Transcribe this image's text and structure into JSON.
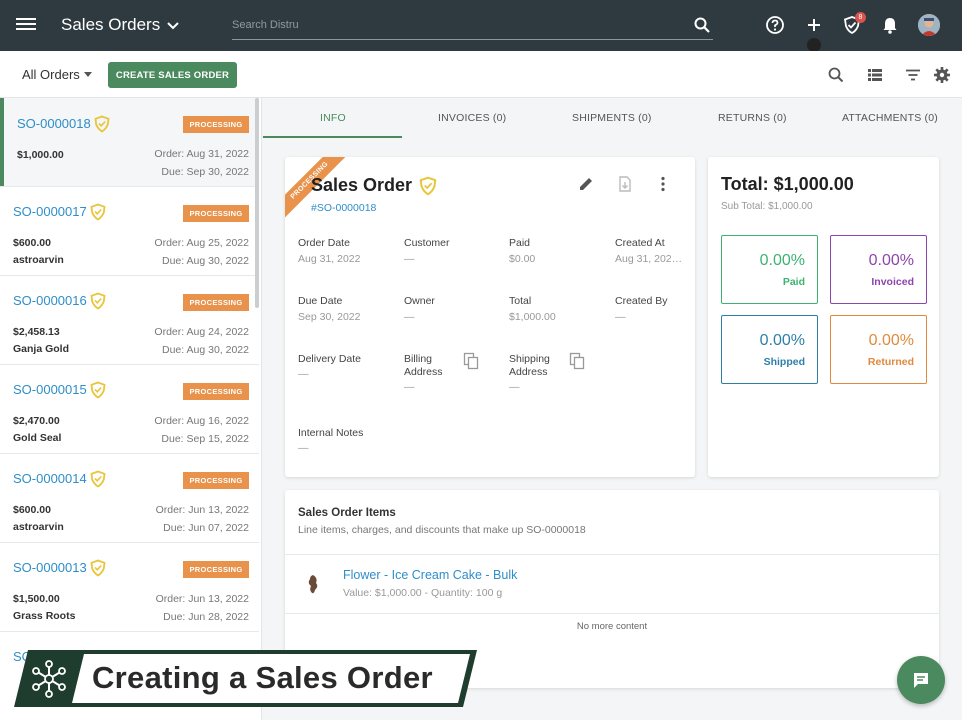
{
  "topbar": {
    "title": "Sales Orders",
    "search_placeholder": "Search Distru",
    "notification_count": "8"
  },
  "toolbar": {
    "filter_label": "All Orders",
    "create_label": "CREATE SALES ORDER"
  },
  "orders": [
    {
      "id": "SO-0000018",
      "status": "PROCESSING",
      "amount": "$1,000.00",
      "customer": "",
      "order_date": "Order: Aug 31, 2022",
      "due_date": "Due: Sep 30, 2022"
    },
    {
      "id": "SO-0000017",
      "status": "PROCESSING",
      "amount": "$600.00",
      "customer": "astroarvin",
      "order_date": "Order: Aug 25, 2022",
      "due_date": "Due: Aug 30, 2022"
    },
    {
      "id": "SO-0000016",
      "status": "PROCESSING",
      "amount": "$2,458.13",
      "customer": "Ganja Gold",
      "order_date": "Order: Aug 24, 2022",
      "due_date": "Due: Aug 30, 2022"
    },
    {
      "id": "SO-0000015",
      "status": "PROCESSING",
      "amount": "$2,470.00",
      "customer": "Gold Seal",
      "order_date": "Order: Aug 16, 2022",
      "due_date": "Due: Sep 15, 2022"
    },
    {
      "id": "SO-0000014",
      "status": "PROCESSING",
      "amount": "$600.00",
      "customer": "astroarvin",
      "order_date": "Order: Jun 13, 2022",
      "due_date": "Due: Jun 07, 2022"
    },
    {
      "id": "SO-0000013",
      "status": "PROCESSING",
      "amount": "$1,500.00",
      "customer": "Grass Roots",
      "order_date": "Order: Jun 13, 2022",
      "due_date": "Due: Jun 28, 2022"
    },
    {
      "id": "SO",
      "status": "",
      "amount": "",
      "customer": "",
      "order_date": "",
      "due_date": ""
    }
  ],
  "tabs": [
    {
      "label": "INFO"
    },
    {
      "label": "INVOICES (0)"
    },
    {
      "label": "SHIPMENTS (0)"
    },
    {
      "label": "RETURNS (0)"
    },
    {
      "label": "ATTACHMENTS (0)"
    }
  ],
  "sales_order": {
    "ribbon": "PROCESSING",
    "title": "Sales Order",
    "number": "#SO-0000018",
    "fields": {
      "order_date": {
        "label": "Order Date",
        "value": "Aug 31, 2022"
      },
      "customer": {
        "label": "Customer",
        "value": "—"
      },
      "paid": {
        "label": "Paid",
        "value": "$0.00"
      },
      "created_at": {
        "label": "Created At",
        "value": "Aug 31, 202…"
      },
      "due_date": {
        "label": "Due Date",
        "value": "Sep 30, 2022"
      },
      "owner": {
        "label": "Owner",
        "value": "—"
      },
      "total": {
        "label": "Total",
        "value": "$1,000.00"
      },
      "created_by": {
        "label": "Created By",
        "value": "—"
      },
      "delivery_date": {
        "label": "Delivery Date",
        "value": "—"
      },
      "billing_address": {
        "label_line1": "Billing",
        "label_line2": "Address",
        "value": "—"
      },
      "shipping_address": {
        "label_line1": "Shipping",
        "label_line2": "Address",
        "value": "—"
      },
      "internal_notes": {
        "label": "Internal Notes",
        "value": "—"
      }
    }
  },
  "totals": {
    "title": "Total: $1,000.00",
    "subtotal": "Sub Total: $1,000.00",
    "stats": [
      {
        "pct": "0.00%",
        "label": "Paid",
        "color": "#3cb371"
      },
      {
        "pct": "0.00%",
        "label": "Invoiced",
        "color": "#8e44ad"
      },
      {
        "pct": "0.00%",
        "label": "Shipped",
        "color": "#2e7fa8"
      },
      {
        "pct": "0.00%",
        "label": "Returned",
        "color": "#e08a3c"
      }
    ]
  },
  "items": {
    "title": "Sales Order Items",
    "subtitle": "Line items, charges, and discounts that make up SO-0000018",
    "rows": [
      {
        "name": "Flower - Ice Cream Cake - Bulk",
        "meta": "Value: $1,000.00 - Quantity: 100 g"
      }
    ],
    "empty_text": "No more content"
  },
  "banner": {
    "text": "Creating a Sales Order"
  },
  "colors": {
    "accent": "#4a8a5e",
    "link": "#2e8ec9",
    "status": "#e8924c",
    "topbar": "#2f3a40"
  }
}
